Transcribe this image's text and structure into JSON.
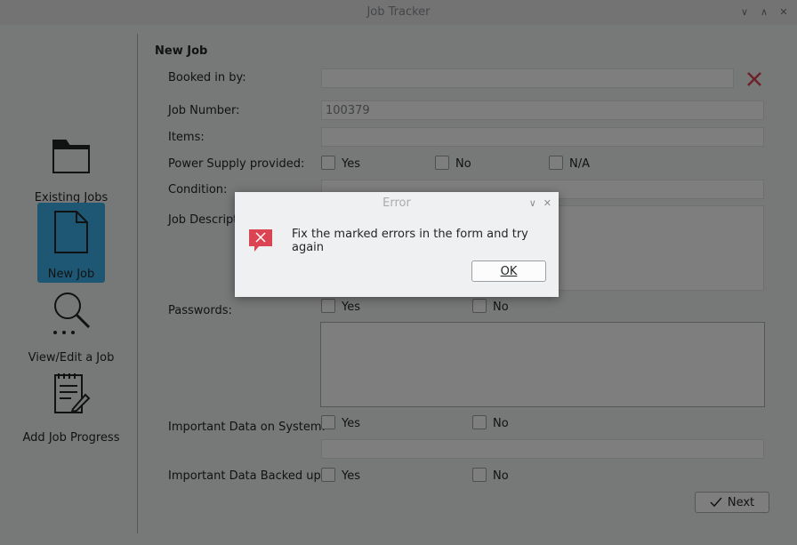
{
  "window": {
    "title": "Job Tracker",
    "controls": [
      "∨",
      "∧",
      "✕"
    ]
  },
  "sidebar": {
    "items": [
      {
        "label": "Existing Jobs",
        "icon": "folder-icon"
      },
      {
        "label": "New Job",
        "icon": "document-icon",
        "active": true
      },
      {
        "label": "View/Edit a Job",
        "icon": "search-icon"
      },
      {
        "label": "Add Job Progress",
        "icon": "edit-document-icon"
      }
    ]
  },
  "form": {
    "section_title": "New Job",
    "booked_in_by": {
      "label": "Booked in by:",
      "value": ""
    },
    "job_number": {
      "label": "Job Number:",
      "value": "100379"
    },
    "items": {
      "label": "Items:",
      "value": ""
    },
    "power_supply": {
      "label": "Power Supply provided:",
      "options": [
        "Yes",
        "No",
        "N/A"
      ]
    },
    "condition": {
      "label": "Condition:",
      "value": ""
    },
    "job_description": {
      "label": "Job Description:",
      "value": ""
    },
    "passwords": {
      "label": "Passwords:",
      "options": [
        "Yes",
        "No"
      ]
    },
    "important_data": {
      "label": "Important Data on System:",
      "options": [
        "Yes",
        "No"
      ]
    },
    "data_backed_up": {
      "label": "Important Data Backed up:",
      "options": [
        "Yes",
        "No"
      ]
    },
    "next_label": "Next"
  },
  "dialog": {
    "title": "Error",
    "message": "Fix the marked errors in the form and try again",
    "ok_label": "OK",
    "controls": [
      "∨",
      "✕"
    ]
  },
  "colors": {
    "accent": "#3daee9",
    "error": "#da4453"
  }
}
